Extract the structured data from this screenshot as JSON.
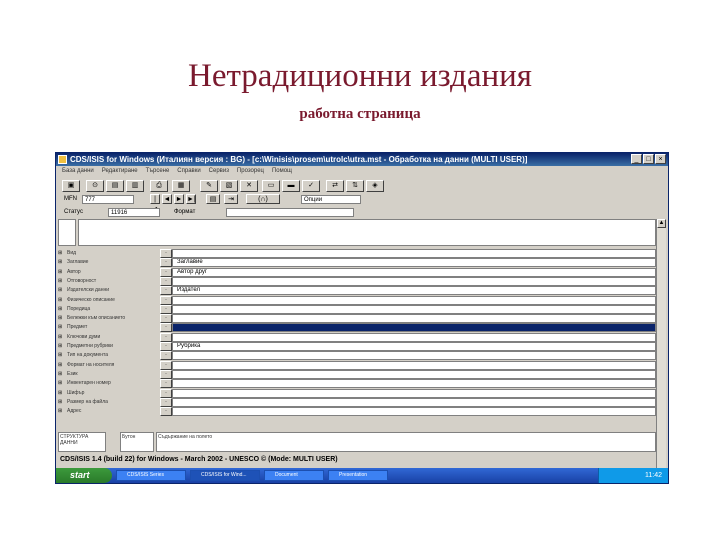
{
  "slide": {
    "title": "Нетрадиционни издания",
    "subtitle": "работна страница"
  },
  "window": {
    "title": "CDS/ISIS for Windows (Италиян версия : BG) - [c:\\Winisis\\prosem\\utrolc\\utrа.mst - Обработка на данни (MULTI USER)]",
    "menu_items": [
      "База данни",
      "Редактиране",
      "Търсене",
      "Справки",
      "Сервиз",
      "Прозорец",
      "Помощ"
    ],
    "toolbar_icons": [
      "open-db-icon",
      "search-icon",
      "browse-icon",
      "index-icon",
      "print-icon",
      "save-icon",
      "edit-icon",
      "new-record-icon",
      "delete-icon",
      "copy-icon",
      "paste-icon",
      "check-icon",
      "export-icon",
      "import-icon",
      "validate-icon"
    ],
    "mfn_label": "MFN",
    "mfn_value": "777",
    "status_label": "Статус",
    "status_value": "11916",
    "format_label": "Формат",
    "format_value": "",
    "options_label": "Опции",
    "fields": [
      {
        "tag": "",
        "name": "Вид",
        "value": "",
        "selected": false
      },
      {
        "tag": "",
        "name": "Заглавие",
        "value": "Заглавие",
        "selected": false
      },
      {
        "tag": "",
        "name": "Автор",
        "value": "Автор друг",
        "selected": false
      },
      {
        "tag": "",
        "name": "Отговорност",
        "value": "",
        "selected": false
      },
      {
        "tag": "",
        "name": "Издателски данни",
        "value": "Издател",
        "selected": false
      },
      {
        "tag": "",
        "name": "Физическо описание",
        "value": "",
        "selected": false
      },
      {
        "tag": "",
        "name": "Поредица",
        "value": "",
        "selected": false
      },
      {
        "tag": "",
        "name": "Бележки към описанието",
        "value": "",
        "selected": false
      },
      {
        "tag": "",
        "name": "Предмет",
        "value": "",
        "selected": true
      },
      {
        "tag": "",
        "name": "Ключови думи",
        "value": "",
        "selected": false
      },
      {
        "tag": "",
        "name": "Предметни рубрики",
        "value": "Рубрика",
        "selected": false
      },
      {
        "tag": "",
        "name": "Тип на документа",
        "value": "",
        "selected": false
      },
      {
        "tag": "",
        "name": "Формат на носителя",
        "value": "",
        "selected": false
      },
      {
        "tag": "",
        "name": "Език",
        "value": "",
        "selected": false
      },
      {
        "tag": "",
        "name": "Инвентарен номер",
        "value": "",
        "selected": false
      },
      {
        "tag": "",
        "name": "Шифър",
        "value": "",
        "selected": false
      },
      {
        "tag": "",
        "name": "Размер на файла",
        "value": "",
        "selected": false
      },
      {
        "tag": "",
        "name": "Адрес",
        "value": "",
        "selected": false
      }
    ],
    "bottom_left": "СТРУКТУРА ДАННИ",
    "bottom_mid": "Бутон",
    "bottom_right": "Съдържание на полето",
    "statusbar": "CDS/ISIS 1.4 (build 22) for Windows - March 2002 - UNESCO © (Mode: MULTI USER)"
  },
  "taskbar": {
    "start_label": "start",
    "items": [
      {
        "label": "CDS/ISIS Series",
        "active": false
      },
      {
        "label": "CDS/ISIS for Wind...",
        "active": true
      },
      {
        "label": "Document",
        "active": false
      },
      {
        "label": "Presentation",
        "active": false
      }
    ],
    "tray_time": "11:42"
  }
}
